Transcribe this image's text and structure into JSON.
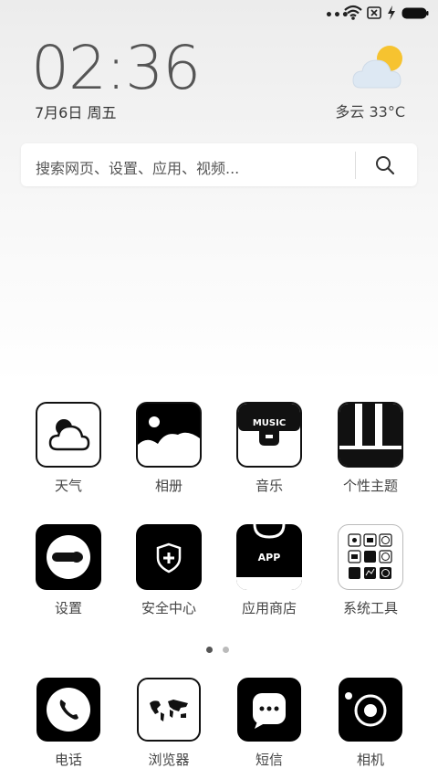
{
  "status": {
    "overflow": "•••"
  },
  "clock": {
    "time": "02:36",
    "date": "7月6日 周五"
  },
  "weather": {
    "text": "多云  33°C"
  },
  "search": {
    "placeholder": "搜索网页、设置、应用、视频..."
  },
  "apps": [
    {
      "label": "天气"
    },
    {
      "label": "相册"
    },
    {
      "label": "音乐",
      "badge": "MUSIC"
    },
    {
      "label": "个性主题"
    },
    {
      "label": "设置"
    },
    {
      "label": "安全中心"
    },
    {
      "label": "应用商店",
      "badge": "APP"
    },
    {
      "label": "系统工具"
    }
  ],
  "dock": [
    {
      "label": "电话"
    },
    {
      "label": "浏览器"
    },
    {
      "label": "短信"
    },
    {
      "label": "相机"
    }
  ],
  "pager": {
    "pages": 2,
    "active": 0
  }
}
